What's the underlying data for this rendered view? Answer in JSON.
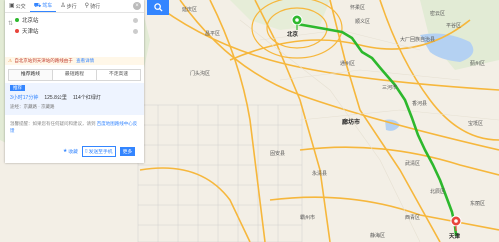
{
  "modes": [
    {
      "label": "公交",
      "icon": "bus-icon",
      "active": false
    },
    {
      "label": "驾车",
      "icon": "car-icon",
      "active": true
    },
    {
      "label": "步行",
      "icon": "walk-icon",
      "active": false
    },
    {
      "label": "骑行",
      "icon": "bike-icon",
      "active": false
    }
  ],
  "route": {
    "start": "北京站",
    "end": "天津站"
  },
  "alert": {
    "text": "自北京站到天津站的路线由于",
    "link": "查看详情"
  },
  "preferences": [
    "推荐路线",
    "最短路程",
    "不走高速"
  ],
  "plan": {
    "tag": "推荐",
    "time": "3小时17分钟",
    "distance": "125.8公里",
    "lights": "114个红绿灯",
    "via": "途经：京藏路 · 京藏路"
  },
  "tip": {
    "text": "温馨提醒：如果您有任何疑问和建议，请到",
    "link": "百度地图路线中心反馈"
  },
  "actions": {
    "collect": "收藏",
    "send": "发送至手机",
    "more": "更多"
  },
  "map": {
    "pin_start_label": "北京",
    "pin_end_label": "天津",
    "places": [
      {
        "name": "延庆区"
      },
      {
        "name": "怀柔区"
      },
      {
        "name": "密云区"
      },
      {
        "name": "昌平区"
      },
      {
        "name": "顺义区"
      },
      {
        "name": "平谷区"
      },
      {
        "name": "门头沟区"
      },
      {
        "name": "通州区"
      },
      {
        "name": "三河市"
      },
      {
        "name": "大厂回族自治县"
      },
      {
        "name": "香河县"
      },
      {
        "name": "廊坊市"
      },
      {
        "name": "武清区"
      },
      {
        "name": "宝坻区"
      },
      {
        "name": "固安县"
      },
      {
        "name": "永清县"
      },
      {
        "name": "北辰区"
      },
      {
        "name": "西青区"
      },
      {
        "name": "东丽区"
      },
      {
        "name": "静海区"
      },
      {
        "name": "蓟州区"
      },
      {
        "name": "霸州市"
      }
    ]
  },
  "colors": {
    "accent": "#3385ff",
    "route": "#2db82d",
    "highway": "#f6b73c",
    "water": "#b4d1f2"
  }
}
